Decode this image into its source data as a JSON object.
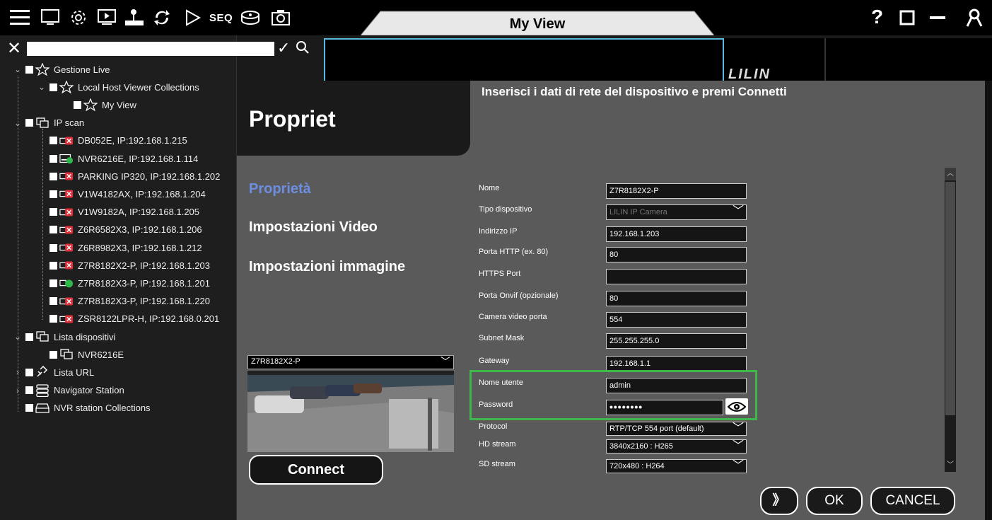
{
  "toolbar": {
    "seq_label": "SEQ",
    "view_tab_title": "My View"
  },
  "window": {
    "help": "?"
  },
  "tree": {
    "items": [
      {
        "label": "Gestione Live"
      },
      {
        "label": "Local Host Viewer Collections"
      },
      {
        "label": "My View"
      },
      {
        "label": "IP scan"
      },
      {
        "label": "DB052E, IP:192.168.1.215"
      },
      {
        "label": "NVR6216E, IP:192.168.1.114"
      },
      {
        "label": "PARKING IP320, IP:192.168.1.202"
      },
      {
        "label": "V1W4182AX, IP:192.168.1.204"
      },
      {
        "label": "V1W9182A, IP:192.168.1.205"
      },
      {
        "label": "Z6R6582X3, IP:192.168.1.206"
      },
      {
        "label": "Z6R8982X3, IP:192.168.1.212"
      },
      {
        "label": "Z7R8182X2-P, IP:192.168.1.203"
      },
      {
        "label": "Z7R8182X3-P, IP:192.168.1.201"
      },
      {
        "label": "Z7R8182X3-P, IP:192.168.1.220"
      },
      {
        "label": "ZSR8122LPR-H, IP:192.168.0.201"
      },
      {
        "label": "Lista dispositivi"
      },
      {
        "label": "NVR6216E"
      },
      {
        "label": "Lista URL"
      },
      {
        "label": "Navigator Station"
      },
      {
        "label": "NVR station Collections"
      }
    ]
  },
  "video": {
    "logo": "LILIN"
  },
  "dialog": {
    "title": "Propriet",
    "message": "Inserisci i dati di rete del dispositivo e premi Connetti",
    "nav": [
      "Proprietà",
      "Impostazioni Video",
      "Impostazioni immagine"
    ],
    "preview_device": "Z7R8182X2-P",
    "connect_label": "Connect",
    "fields": [
      {
        "label": "Nome",
        "value": "Z7R8182X2-P"
      },
      {
        "label": "Tipo dispositivo",
        "value": "LILIN IP Camera"
      },
      {
        "label": "Indirizzo IP",
        "value": "192.168.1.203"
      },
      {
        "label": "Porta HTTP (ex. 80)",
        "value": "80"
      },
      {
        "label": "HTTPS Port",
        "value": ""
      },
      {
        "label": "Porta Onvif (opzionale)",
        "value": "80"
      },
      {
        "label": "Camera video porta",
        "value": "554"
      },
      {
        "label": "Subnet Mask",
        "value": "255.255.255.0"
      },
      {
        "label": "Gateway",
        "value": "192.168.1.1"
      },
      {
        "label": "Nome utente",
        "value": "admin"
      },
      {
        "label": "Password",
        "value": "••••••••"
      },
      {
        "label": "Protocol",
        "value": "RTP/TCP 554 port (default)"
      },
      {
        "label": "HD stream",
        "value": "3840x2160 : H265"
      },
      {
        "label": "SD stream",
        "value": "720x480 : H264"
      }
    ],
    "buttons": {
      "next": "》",
      "ok": "OK",
      "cancel": "CANCEL"
    }
  },
  "colors": {
    "accent_link": "#6d8ee0",
    "highlight_green": "#3fb74a",
    "video_select_blue": "#5bb9e0",
    "offline_red": "#e0303a",
    "online_green": "#2fb84a"
  }
}
